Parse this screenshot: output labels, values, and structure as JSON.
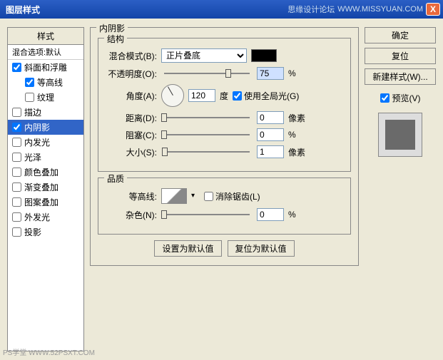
{
  "title": "图层样式",
  "titlebar_right": "思缘设计论坛",
  "titlebar_url": "WWW.MISSYUAN.COM",
  "close": "X",
  "styles": {
    "header": "样式",
    "subheader": "混合选项:默认",
    "items": [
      {
        "label": "斜面和浮雕",
        "checked": true,
        "selected": false
      },
      {
        "label": "等高线",
        "checked": true,
        "selected": false,
        "indent": true
      },
      {
        "label": "纹理",
        "checked": false,
        "selected": false,
        "indent": true
      },
      {
        "label": "描边",
        "checked": false,
        "selected": false
      },
      {
        "label": "内阴影",
        "checked": true,
        "selected": true
      },
      {
        "label": "内发光",
        "checked": false,
        "selected": false
      },
      {
        "label": "光泽",
        "checked": false,
        "selected": false
      },
      {
        "label": "颜色叠加",
        "checked": false,
        "selected": false
      },
      {
        "label": "渐变叠加",
        "checked": false,
        "selected": false
      },
      {
        "label": "图案叠加",
        "checked": false,
        "selected": false
      },
      {
        "label": "外发光",
        "checked": false,
        "selected": false
      },
      {
        "label": "投影",
        "checked": false,
        "selected": false
      }
    ]
  },
  "main": {
    "section_title": "内阴影",
    "structure": {
      "legend": "结构",
      "blend_mode_label": "混合模式(B):",
      "blend_mode_value": "正片叠底",
      "color": "#000000",
      "opacity_label": "不透明度(O):",
      "opacity_value": "75",
      "opacity_unit": "%",
      "angle_label": "角度(A):",
      "angle_value": "120",
      "angle_unit": "度",
      "global_light_label": "使用全局光(G)",
      "global_light_checked": true,
      "distance_label": "距离(D):",
      "distance_value": "0",
      "distance_unit": "像素",
      "choke_label": "阻塞(C):",
      "choke_value": "0",
      "choke_unit": "%",
      "size_label": "大小(S):",
      "size_value": "1",
      "size_unit": "像素"
    },
    "quality": {
      "legend": "品质",
      "contour_label": "等高线:",
      "antialias_label": "消除锯齿(L)",
      "antialias_checked": false,
      "noise_label": "杂色(N):",
      "noise_value": "0",
      "noise_unit": "%"
    },
    "buttons": {
      "set_default": "设置为默认值",
      "reset_default": "复位为默认值"
    }
  },
  "right": {
    "ok": "确定",
    "cancel": "复位",
    "new_style": "新建样式(W)...",
    "preview_label": "预览(V)",
    "preview_checked": true
  },
  "watermark": "PS学堂  WWW.52PSXT.COM"
}
